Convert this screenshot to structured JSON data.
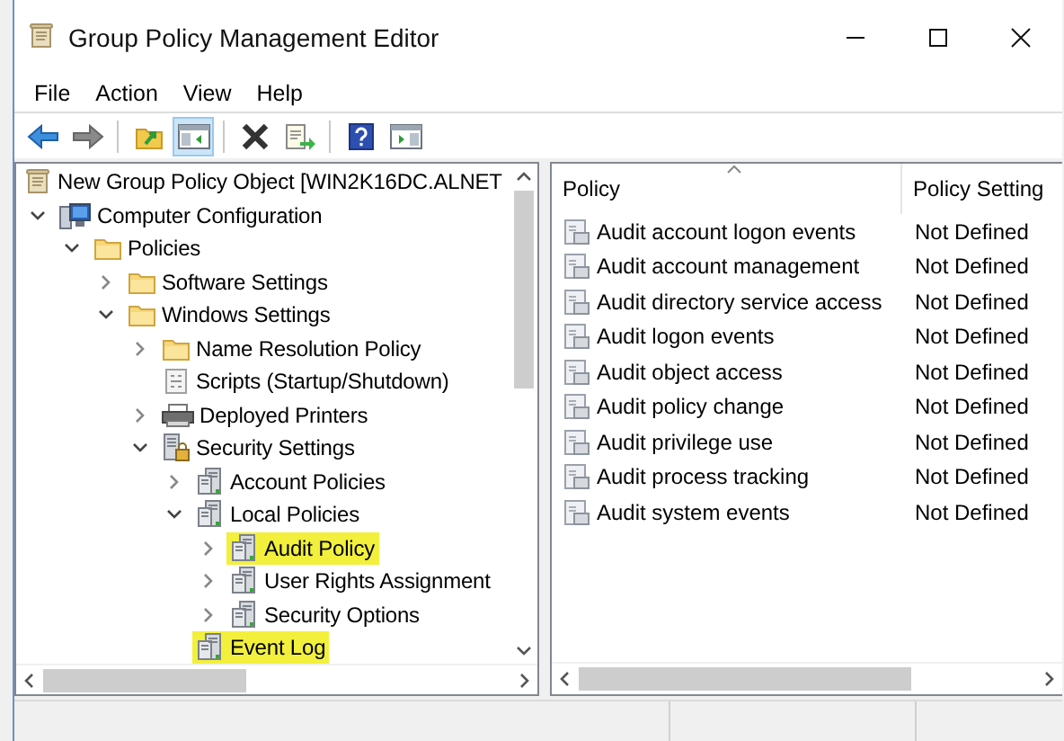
{
  "window": {
    "title": "Group Policy Management Editor"
  },
  "menu": [
    "File",
    "Action",
    "View",
    "Help"
  ],
  "toolbar": [
    [
      {
        "kind": "back",
        "pressed": false,
        "disabled": false
      },
      {
        "kind": "forward",
        "pressed": false,
        "disabled": true
      }
    ],
    [
      {
        "kind": "folder-up",
        "pressed": false,
        "disabled": false
      },
      {
        "kind": "tree-pane",
        "pressed": true,
        "disabled": false
      }
    ],
    [
      {
        "kind": "delete",
        "pressed": false,
        "disabled": false
      },
      {
        "kind": "export",
        "pressed": false,
        "disabled": false
      }
    ],
    [
      {
        "kind": "help",
        "pressed": false,
        "disabled": false
      },
      {
        "kind": "action-pane",
        "pressed": false,
        "disabled": false
      }
    ]
  ],
  "tree": [
    {
      "label": "New Group Policy Object [WIN2K16DC.ALNET",
      "kind": "gpo",
      "highlighted": false,
      "children": [
        {
          "label": "Computer Configuration",
          "kind": "computer",
          "expanded": true,
          "highlighted": false,
          "children": [
            {
              "label": "Policies",
              "kind": "folder",
              "expanded": true,
              "highlighted": false,
              "children": [
                {
                  "label": "Software Settings",
                  "kind": "folder",
                  "expanded": false,
                  "highlighted": false
                },
                {
                  "label": "Windows Settings",
                  "kind": "folder",
                  "expanded": true,
                  "highlighted": false,
                  "children": [
                    {
                      "label": "Name Resolution Policy",
                      "kind": "folder",
                      "expanded": false,
                      "highlighted": false
                    },
                    {
                      "label": "Scripts (Startup/Shutdown)",
                      "kind": "script",
                      "highlighted": false
                    },
                    {
                      "label": "Deployed Printers",
                      "kind": "printer",
                      "expanded": false,
                      "highlighted": false
                    },
                    {
                      "label": "Security Settings",
                      "kind": "security",
                      "expanded": true,
                      "highlighted": false,
                      "children": [
                        {
                          "label": "Account Policies",
                          "kind": "policy",
                          "expanded": false,
                          "highlighted": false
                        },
                        {
                          "label": "Local Policies",
                          "kind": "policy",
                          "expanded": true,
                          "highlighted": false,
                          "children": [
                            {
                              "label": "Audit Policy",
                              "kind": "policy",
                              "expanded": false,
                              "highlighted": true
                            },
                            {
                              "label": "User Rights Assignment",
                              "kind": "policy",
                              "expanded": false,
                              "highlighted": false
                            },
                            {
                              "label": "Security Options",
                              "kind": "policy",
                              "expanded": false,
                              "highlighted": false
                            }
                          ]
                        },
                        {
                          "label": "Event Log",
                          "kind": "policy",
                          "highlighted": true
                        }
                      ]
                    }
                  ]
                }
              ]
            }
          ]
        }
      ]
    }
  ],
  "list": {
    "columns": [
      {
        "label": "Policy",
        "sorted": true
      },
      {
        "label": "Policy Setting",
        "sorted": false
      }
    ],
    "rows": [
      {
        "policy": "Audit account logon events",
        "setting": "Not Defined"
      },
      {
        "policy": "Audit account management",
        "setting": "Not Defined"
      },
      {
        "policy": "Audit directory service access",
        "setting": "Not Defined"
      },
      {
        "policy": "Audit logon events",
        "setting": "Not Defined"
      },
      {
        "policy": "Audit object access",
        "setting": "Not Defined"
      },
      {
        "policy": "Audit policy change",
        "setting": "Not Defined"
      },
      {
        "policy": "Audit privilege use",
        "setting": "Not Defined"
      },
      {
        "policy": "Audit process tracking",
        "setting": "Not Defined"
      },
      {
        "policy": "Audit system events",
        "setting": "Not Defined"
      }
    ]
  }
}
